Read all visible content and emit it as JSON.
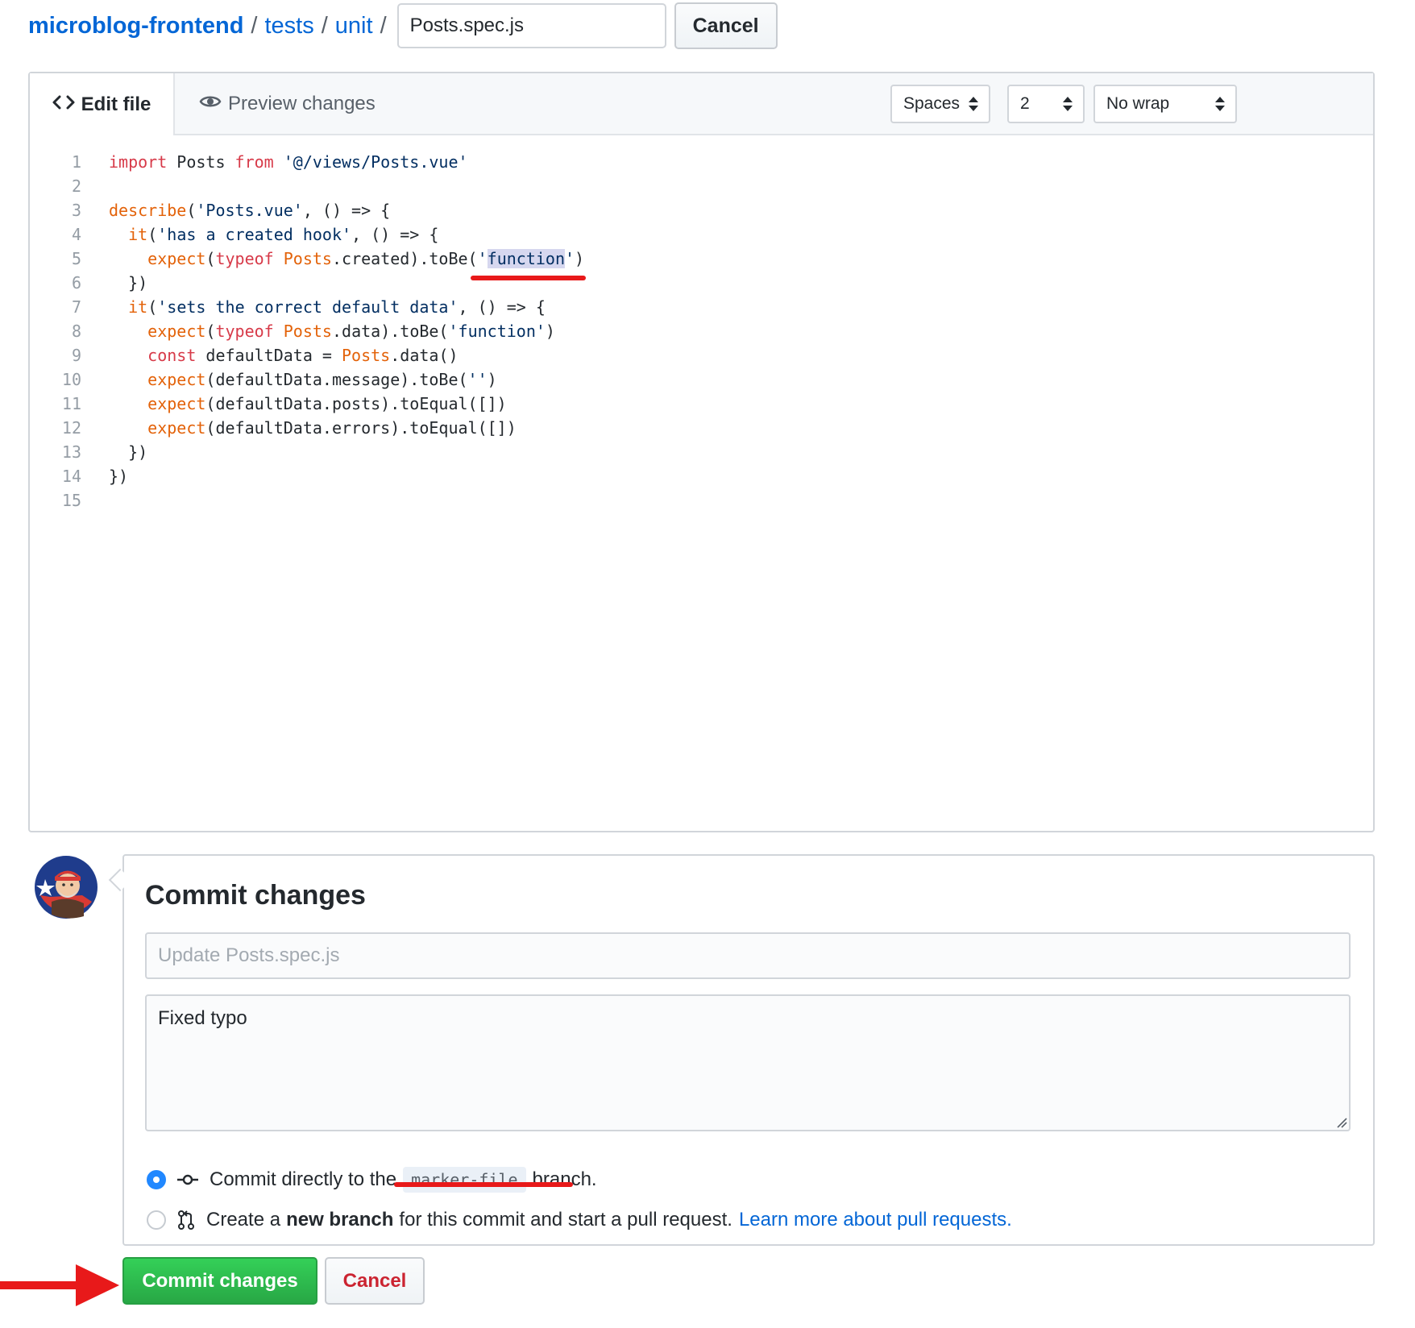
{
  "breadcrumb": {
    "repo": "microblog-frontend",
    "folders": [
      "tests",
      "unit"
    ],
    "separator": "/",
    "filename_value": "Posts.spec.js",
    "cancel_label": "Cancel"
  },
  "editor": {
    "tab_edit_label": "Edit file",
    "tab_preview_label": "Preview changes",
    "indent_mode": "Spaces",
    "indent_size": "2",
    "wrap_mode": "No wrap",
    "line_numbers": [
      "1",
      "2",
      "3",
      "4",
      "5",
      "6",
      "7",
      "8",
      "9",
      "10",
      "11",
      "12",
      "13",
      "14",
      "15"
    ],
    "code_lines": [
      "import Posts from '@/views/Posts.vue'",
      "",
      "describe('Posts.vue', () => {",
      "  it('has a created hook', () => {",
      "    expect(typeof Posts.created).toBe('function')",
      "  })",
      "  it('sets the correct default data', () => {",
      "    expect(typeof Posts.data).toBe('function')",
      "    const defaultData = Posts.data()",
      "    expect(defaultData.message).toBe('')",
      "    expect(defaultData.posts).toEqual([])",
      "    expect(defaultData.errors).toEqual([])",
      "  })",
      "})",
      ""
    ],
    "highlighted_word": "function"
  },
  "commit": {
    "title": "Commit changes",
    "summary_placeholder": "Update Posts.spec.js",
    "description_value": "Fixed typo",
    "option_direct_prefix": "Commit directly to the",
    "branch_name": "marker-file",
    "option_direct_suffix": "branch.",
    "option_new_prefix": "Create a",
    "option_new_bold": "new branch",
    "option_new_suffix": "for this commit and start a pull request.",
    "learn_more_link": "Learn more about pull requests.",
    "commit_button_label": "Commit changes",
    "cancel_button_label": "Cancel"
  },
  "colors": {
    "link": "#0366d6",
    "keyword": "#d73a49",
    "function": "#e36209",
    "string": "#032f62",
    "commit_green": "#28a745",
    "annotation_red": "#e8191a"
  },
  "icons": [
    "code-icon",
    "eye-icon",
    "git-commit-icon",
    "git-pull-request-icon",
    "select-caret-icon",
    "red-arrow-annotation"
  ]
}
